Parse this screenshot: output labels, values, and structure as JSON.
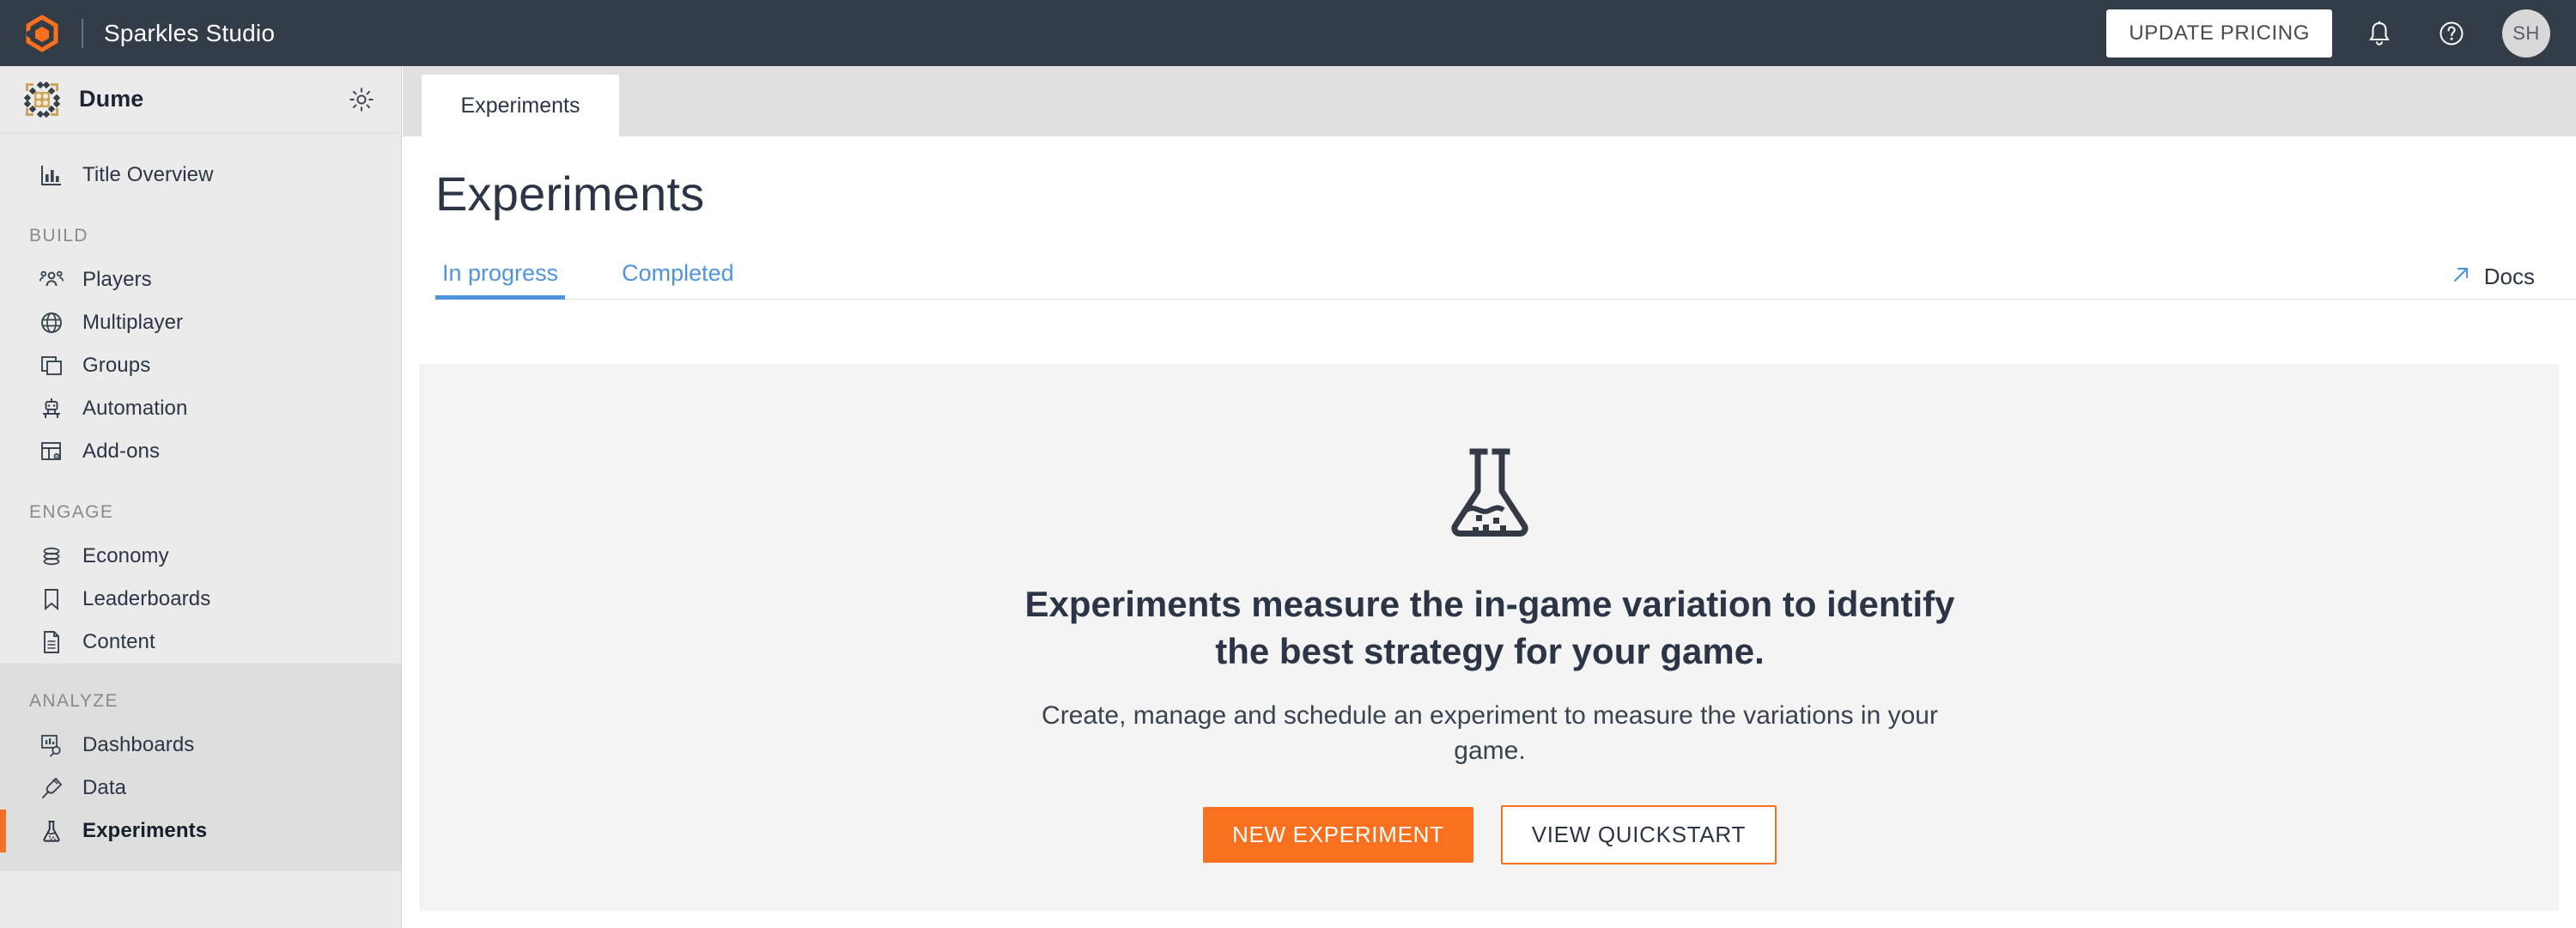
{
  "topbar": {
    "logo_icon": "hexagon-logo-icon",
    "brand": "Sparkles Studio",
    "update_pricing_label": "UPDATE PRICING",
    "bell_icon": "bell-icon",
    "help_icon": "help-circle-icon",
    "avatar_initials": "SH",
    "background": "#333d47",
    "accent": "#f9701f"
  },
  "sidebar": {
    "title": {
      "name": "Dume",
      "avatar_icon": "game-avatar-icon",
      "settings_icon": "gear-icon"
    },
    "overview": {
      "label": "Title Overview",
      "icon": "bar-chart-icon"
    },
    "sections": [
      {
        "label": "BUILD",
        "items": [
          {
            "label": "Players",
            "icon": "people-icon",
            "active": false
          },
          {
            "label": "Multiplayer",
            "icon": "globe-icon",
            "active": false
          },
          {
            "label": "Groups",
            "icon": "layers-icon",
            "active": false
          },
          {
            "label": "Automation",
            "icon": "robot-icon",
            "active": false
          },
          {
            "label": "Add-ons",
            "icon": "addons-grid-icon",
            "active": false
          }
        ]
      },
      {
        "label": "ENGAGE",
        "items": [
          {
            "label": "Economy",
            "icon": "coins-stack-icon",
            "active": false
          },
          {
            "label": "Leaderboards",
            "icon": "bookmark-icon",
            "active": false
          },
          {
            "label": "Content",
            "icon": "document-icon",
            "active": false
          }
        ]
      },
      {
        "label": "ANALYZE",
        "items": [
          {
            "label": "Dashboards",
            "icon": "dashboard-search-icon",
            "active": false
          },
          {
            "label": "Data",
            "icon": "plug-icon",
            "active": false
          },
          {
            "label": "Experiments",
            "icon": "flask-icon",
            "active": true
          }
        ]
      }
    ]
  },
  "main": {
    "tab": {
      "label": "Experiments"
    },
    "page_title": "Experiments",
    "subtabs": [
      {
        "label": "In progress",
        "active": true
      },
      {
        "label": "Completed",
        "active": false
      }
    ],
    "docs": {
      "label": "Docs",
      "icon": "external-link-arrow-icon"
    },
    "empty_state": {
      "illustration_icon": "flask-icon",
      "heading": "Experiments measure the in-game variation to identify the best strategy for your game.",
      "subtext": "Create, manage and schedule an experiment to measure the variations in your game.",
      "primary_button": "NEW EXPERIMENT",
      "secondary_button": "VIEW QUICKSTART"
    }
  }
}
